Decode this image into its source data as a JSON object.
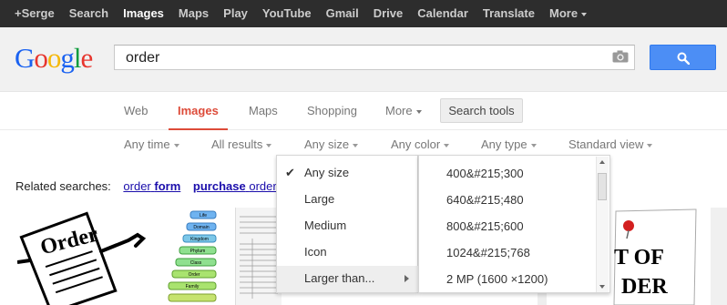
{
  "topbar": {
    "items": [
      {
        "label": "+Serge",
        "active": false
      },
      {
        "label": "Search",
        "active": false
      },
      {
        "label": "Images",
        "active": true
      },
      {
        "label": "Maps",
        "active": false
      },
      {
        "label": "Play",
        "active": false
      },
      {
        "label": "YouTube",
        "active": false
      },
      {
        "label": "Gmail",
        "active": false
      },
      {
        "label": "Drive",
        "active": false
      },
      {
        "label": "Calendar",
        "active": false
      },
      {
        "label": "Translate",
        "active": false
      }
    ],
    "more_label": "More"
  },
  "header": {
    "logo_letters": [
      "G",
      "o",
      "o",
      "g",
      "l",
      "e"
    ],
    "search_value": "order",
    "camera_icon": "camera-icon",
    "search_button_icon": "magnifier-icon"
  },
  "tabs": {
    "web": "Web",
    "images": "Images",
    "maps": "Maps",
    "shopping": "Shopping",
    "more": "More",
    "search_tools": "Search tools"
  },
  "filters": {
    "any_time": "Any time",
    "all_results": "All results",
    "any_size": "Any size",
    "any_color": "Any color",
    "any_type": "Any type",
    "standard_view": "Standard view"
  },
  "related": {
    "label": "Related searches:",
    "link1_plain": "order",
    "link1_bold": "form",
    "link2_bold": "purchase",
    "link2_plain": "order"
  },
  "size_menu": {
    "items": [
      "Any size",
      "Large",
      "Medium",
      "Icon",
      "Larger than..."
    ],
    "checked_item": "Any size",
    "highlighted_item": "Larger than..."
  },
  "sub_menu": {
    "items": [
      "400&#215;300",
      "640&#215;480",
      "800&#215;600",
      "1024&#215;768",
      "2 MP (1600 ×1200)"
    ]
  },
  "thumbnails": {
    "thumb2_labels": [
      "Life",
      "Domain",
      "Kingdom",
      "Phylum",
      "Class",
      "Order",
      "Family"
    ],
    "thumb5_lines": [
      "T OF",
      "DER"
    ]
  },
  "colors": {
    "accent_red": "#dd4b39",
    "search_blue": "#4c8ef5",
    "link_blue": "#1a0dab",
    "topbar_bg": "#2d2d2d"
  }
}
